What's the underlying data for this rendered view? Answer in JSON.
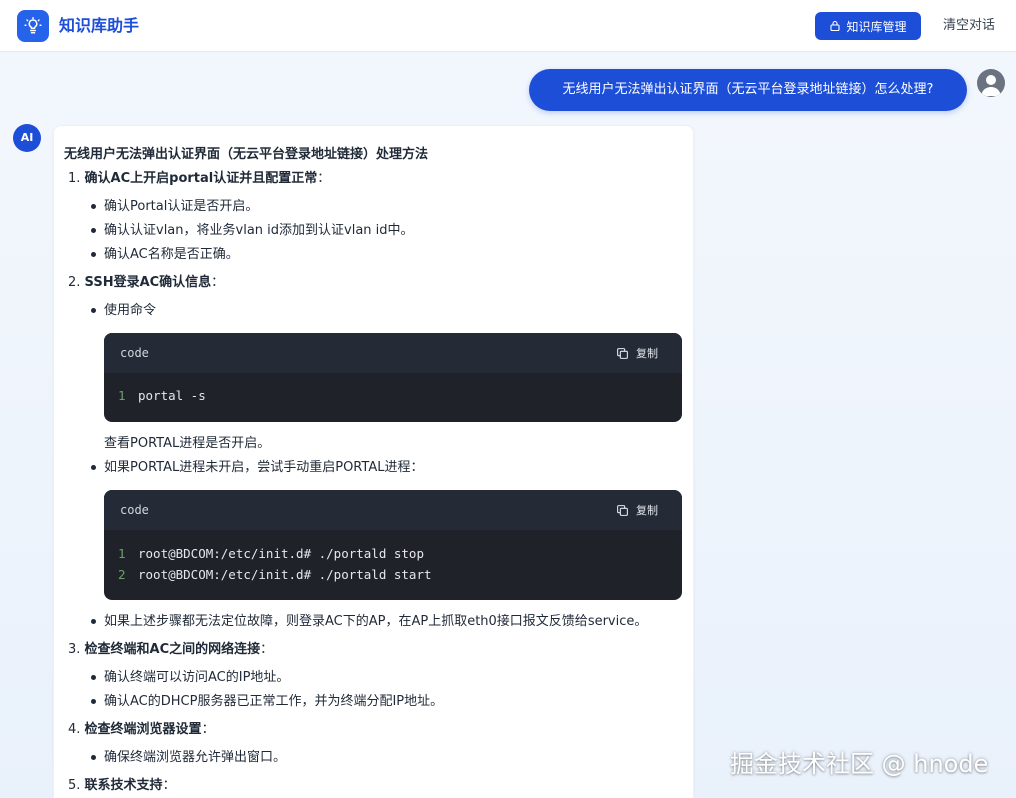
{
  "header": {
    "title": "知识库助手",
    "kb_button": "知识库管理",
    "clear_button": "清空对话"
  },
  "user_message": "无线用户无法弹出认证界面（无云平台登录地址链接）怎么处理?",
  "ai_avatar": "AI",
  "answer": {
    "heading": "无线用户无法弹出认证界面（无云平台登录地址链接）处理方法",
    "steps": [
      {
        "num": "1.",
        "title": "确认AC上开启portal认证并且配置正常",
        "suffix": "：",
        "items": [
          "确认Portal认证是否开启。",
          "确认认证vlan，将业务vlan id添加到认证vlan id中。",
          "确认AC名称是否正确。"
        ]
      },
      {
        "num": "2.",
        "title": "SSH登录AC确认信息",
        "suffix": "：",
        "item1": "使用命令",
        "after_code1": "查看PORTAL进程是否开启。",
        "item2": "如果PORTAL进程未开启，尝试手动重启PORTAL进程：",
        "item3": "如果上述步骤都无法定位故障，则登录AC下的AP，在AP上抓取eth0接口报文反馈给service。"
      },
      {
        "num": "3.",
        "title": "检查终端和AC之间的网络连接",
        "suffix": "：",
        "items": [
          "确认终端可以访问AC的IP地址。",
          "确认AC的DHCP服务器已正常工作，并为终端分配IP地址。"
        ]
      },
      {
        "num": "4.",
        "title": "检查终端浏览器设置",
        "suffix": "：",
        "items": [
          "确保终端浏览器允许弹出窗口。"
        ]
      },
      {
        "num": "5.",
        "title": "联系技术支持",
        "suffix": "："
      }
    ]
  },
  "code_blocks": [
    {
      "lang": "code",
      "copy_label": "复制",
      "lines": [
        {
          "n": "1",
          "text": "portal -s"
        }
      ]
    },
    {
      "lang": "code",
      "copy_label": "复制",
      "lines": [
        {
          "n": "1",
          "text": "root@BDCOM:/etc/init.d# ./portald stop"
        },
        {
          "n": "2",
          "text": "root@BDCOM:/etc/init.d# ./portald start"
        }
      ]
    }
  ],
  "watermark": "掘金技术社区 @ hnode"
}
